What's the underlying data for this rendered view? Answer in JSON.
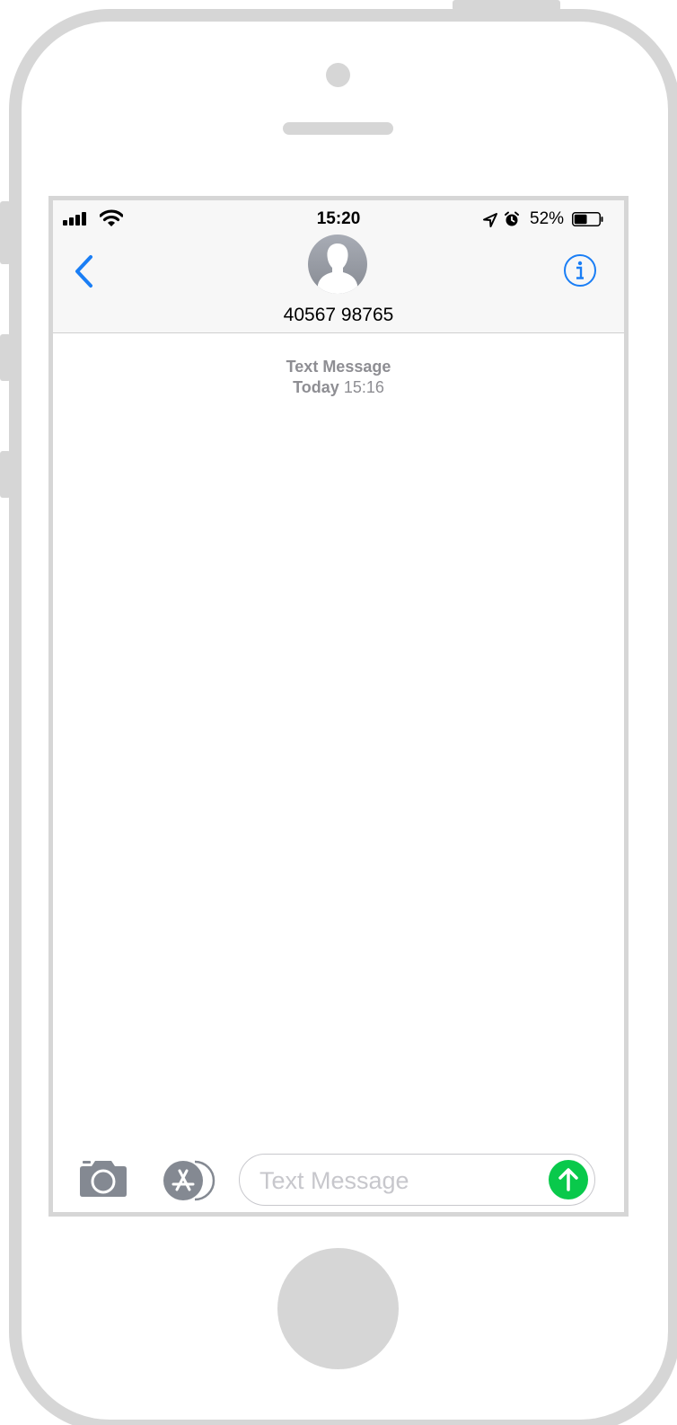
{
  "status_bar": {
    "time": "15:20",
    "battery_percent": "52%",
    "battery_level": 0.52,
    "icons": [
      "signal-icon",
      "wifi-icon",
      "location-icon",
      "alarm-icon",
      "battery-icon"
    ]
  },
  "header": {
    "contact_name": "40567 98765",
    "back_icon": "chevron-left-icon",
    "info_icon": "info-icon",
    "avatar_icon": "person-silhouette-icon"
  },
  "conversation": {
    "service_label": "Text Message",
    "day_label": "Today",
    "time_label": "15:16"
  },
  "composer": {
    "placeholder": "Text Message",
    "camera_icon": "camera-icon",
    "apps_icon": "app-store-icon",
    "send_icon": "arrow-up-icon"
  },
  "colors": {
    "accent": "#1a7ef5",
    "send_green": "#09c94b",
    "meta_gray": "#8e8e93",
    "frame_gray": "#d6d6d6"
  }
}
